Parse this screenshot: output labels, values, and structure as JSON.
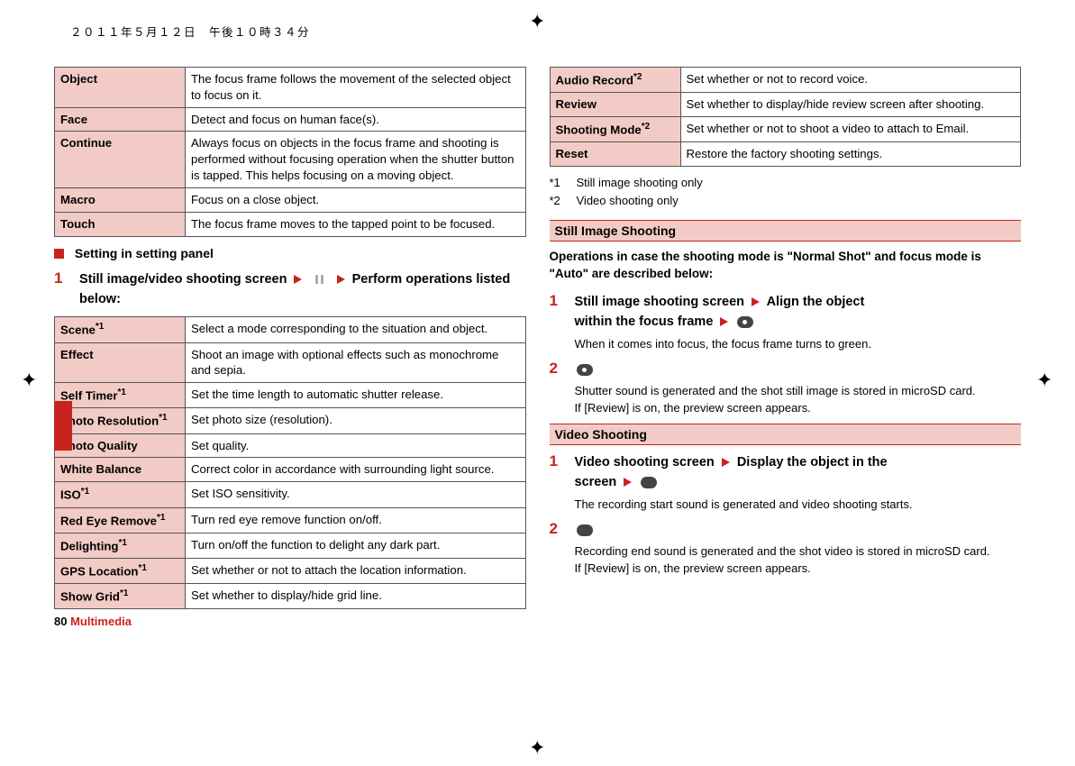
{
  "header": {
    "date": "２０１１年５月１２日　午後１０時３４分"
  },
  "leftCol": {
    "table1": {
      "rows": [
        {
          "label": "Object",
          "desc": "The focus frame follows the movement of the selected object to focus on it."
        },
        {
          "label": "Face",
          "desc": "Detect and focus on human face(s)."
        },
        {
          "label": "Continue",
          "desc": "Always focus on objects in the focus frame and shooting is performed without focusing operation when the shutter button is tapped. This helps focusing on a moving object."
        },
        {
          "label": "Macro",
          "desc": "Focus on a close object."
        },
        {
          "label": "Touch",
          "desc": "The focus frame moves to the tapped point to be focused."
        }
      ]
    },
    "sectionTitle": "Setting in setting panel",
    "step1": {
      "num": "1",
      "before": "Still image/video shooting screen",
      "after": "Perform operations listed below:"
    },
    "table2": {
      "rows": [
        {
          "label": "Scene",
          "sup": "*1",
          "desc": "Select a mode corresponding to the situation and object."
        },
        {
          "label": "Effect",
          "sup": "",
          "desc": "Shoot an image with optional effects such as monochrome and sepia."
        },
        {
          "label": "Self Timer",
          "sup": "*1",
          "desc": "Set the time length to automatic shutter release."
        },
        {
          "label": "Photo Resolution",
          "sup": "*1",
          "desc": "Set photo size (resolution)."
        },
        {
          "label": "Photo Quality",
          "sup": "",
          "desc": "Set quality."
        },
        {
          "label": "White Balance",
          "sup": "",
          "desc": "Correct color in accordance with surrounding light source."
        },
        {
          "label": "ISO",
          "sup": "*1",
          "desc": "Set ISO sensitivity."
        },
        {
          "label": "Red Eye Remove",
          "sup": "*1",
          "desc": "Turn red eye remove function on/off."
        },
        {
          "label": "Delighting",
          "sup": "*1",
          "desc": "Turn on/off the function to delight any dark part."
        },
        {
          "label": "GPS Location",
          "sup": "*1",
          "desc": "Set whether or not to attach the location information."
        },
        {
          "label": "Show Grid",
          "sup": "*1",
          "desc": "Set whether to display/hide grid line."
        }
      ]
    },
    "footer": {
      "page": "80",
      "section": "Multimedia"
    }
  },
  "rightCol": {
    "table3": {
      "rows": [
        {
          "label": "Audio Record",
          "sup": "*2",
          "desc": "Set whether or not to record voice."
        },
        {
          "label": "Review",
          "sup": "",
          "desc": "Set whether to display/hide review screen after shooting."
        },
        {
          "label": "Shooting Mode",
          "sup": "*2",
          "desc": "Set whether or not to shoot a video to attach to Email."
        },
        {
          "label": "Reset",
          "sup": "",
          "desc": "Restore the factory shooting settings."
        }
      ]
    },
    "footnotes": [
      {
        "label": "*1",
        "text": "Still image shooting only"
      },
      {
        "label": "*2",
        "text": "Video shooting only"
      }
    ],
    "stillImage": {
      "header": "Still Image Shooting",
      "intro": "Operations in case the shooting mode is \"Normal Shot\" and focus mode is \"Auto\" are described below:",
      "step1": {
        "num": "1",
        "line1a": "Still image shooting screen",
        "line1b": "Align the object",
        "line2": "within the focus frame",
        "desc": "When it comes into focus, the focus frame turns to green."
      },
      "step2": {
        "num": "2",
        "desc1": "Shutter sound is generated and the shot still image is stored in microSD card.",
        "desc2": "If [Review] is on, the preview screen appears."
      }
    },
    "video": {
      "header": "Video Shooting",
      "step1": {
        "num": "1",
        "line1a": "Video shooting screen",
        "line1b": "Display the object in the",
        "line2": "screen",
        "desc": "The recording start sound is generated and video shooting starts."
      },
      "step2": {
        "num": "2",
        "desc1": "Recording end sound is generated and the shot video is stored in microSD card.",
        "desc2": "If [Review] is on, the preview screen appears."
      }
    }
  }
}
